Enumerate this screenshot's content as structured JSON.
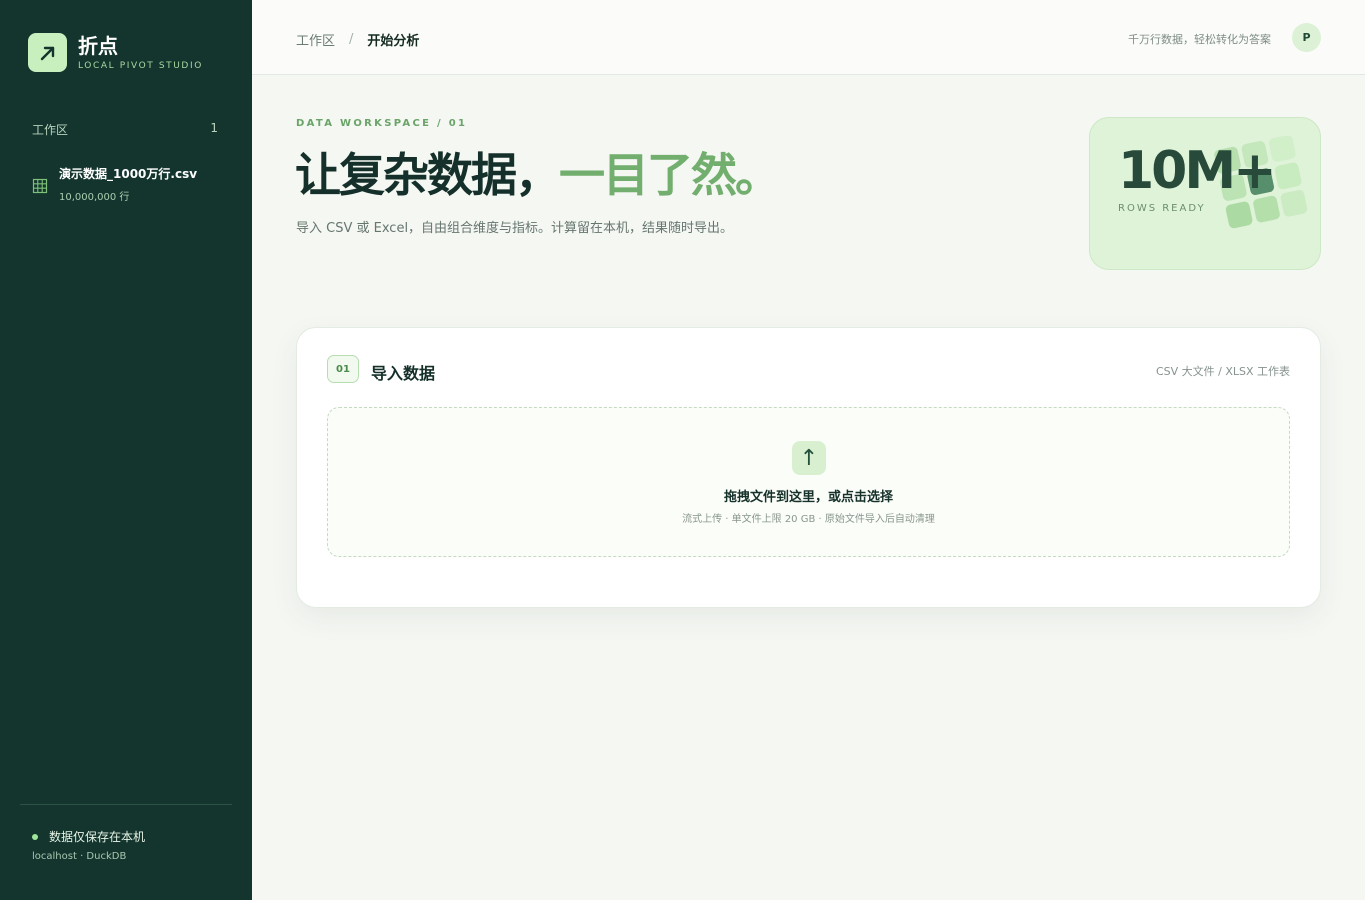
{
  "brand": {
    "name": "折点",
    "subtitle": "LOCAL PIVOT STUDIO",
    "logo_icon": "arrow-up-right-icon"
  },
  "sidebar": {
    "workspace_label": "工作区",
    "workspace_count": "1",
    "files": [
      {
        "name": "演示数据_1000万行.csv",
        "rows": "10,000,000 行",
        "icon": "table-grid-icon"
      }
    ],
    "footer": {
      "status": "数据仅保存在本机",
      "engine": "localhost · DuckDB"
    }
  },
  "topbar": {
    "breadcrumb": [
      "工作区",
      "/",
      "开始分析"
    ],
    "tagline": "千万行数据，轻松转化为答案",
    "avatar": "P"
  },
  "hero": {
    "eyebrow": "DATA WORKSPACE / 01",
    "title_main": "让复杂数据，",
    "title_accent": "一目了然。",
    "subtitle": "导入 CSV 或 Excel，自由组合维度与指标。计算留在本机，结果随时导出。"
  },
  "stat": {
    "value": "10M+",
    "label": "ROWS READY"
  },
  "import": {
    "step": "01",
    "title": "导入数据",
    "formats": "CSV 大文件 / XLSX 工作表",
    "drop_title": "拖拽文件到这里，或点击选择",
    "drop_hint": "流式上传 · 单文件上限 20 GB · 原始文件导入后自动清理",
    "upload_icon": "↑"
  },
  "colors": {
    "sidebar_bg": "#13352d",
    "accent": "#72ae6d",
    "page_bg": "#f5f7f3",
    "stat_bg": "#dff3d8"
  }
}
